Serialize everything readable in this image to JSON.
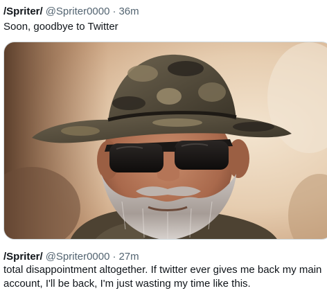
{
  "tweets": [
    {
      "display_name": "/Spriter/",
      "handle": "@Spriter0000",
      "separator": "·",
      "time": "36m",
      "text": "Soon, goodbye to Twitter",
      "media": {
        "kind": "photo",
        "subject": "bearded-man-in-camo-hat-and-sunglasses"
      }
    },
    {
      "display_name": "/Spriter/",
      "handle": "@Spriter0000",
      "separator": "·",
      "time": "27m",
      "text": "total disappointment altogether. If twitter ever gives me back my main account, I'll be back, I'm just wasting my time like this."
    }
  ],
  "colors": {
    "text_primary": "#0f1419",
    "text_secondary": "#536471",
    "border": "#cfd9de"
  }
}
